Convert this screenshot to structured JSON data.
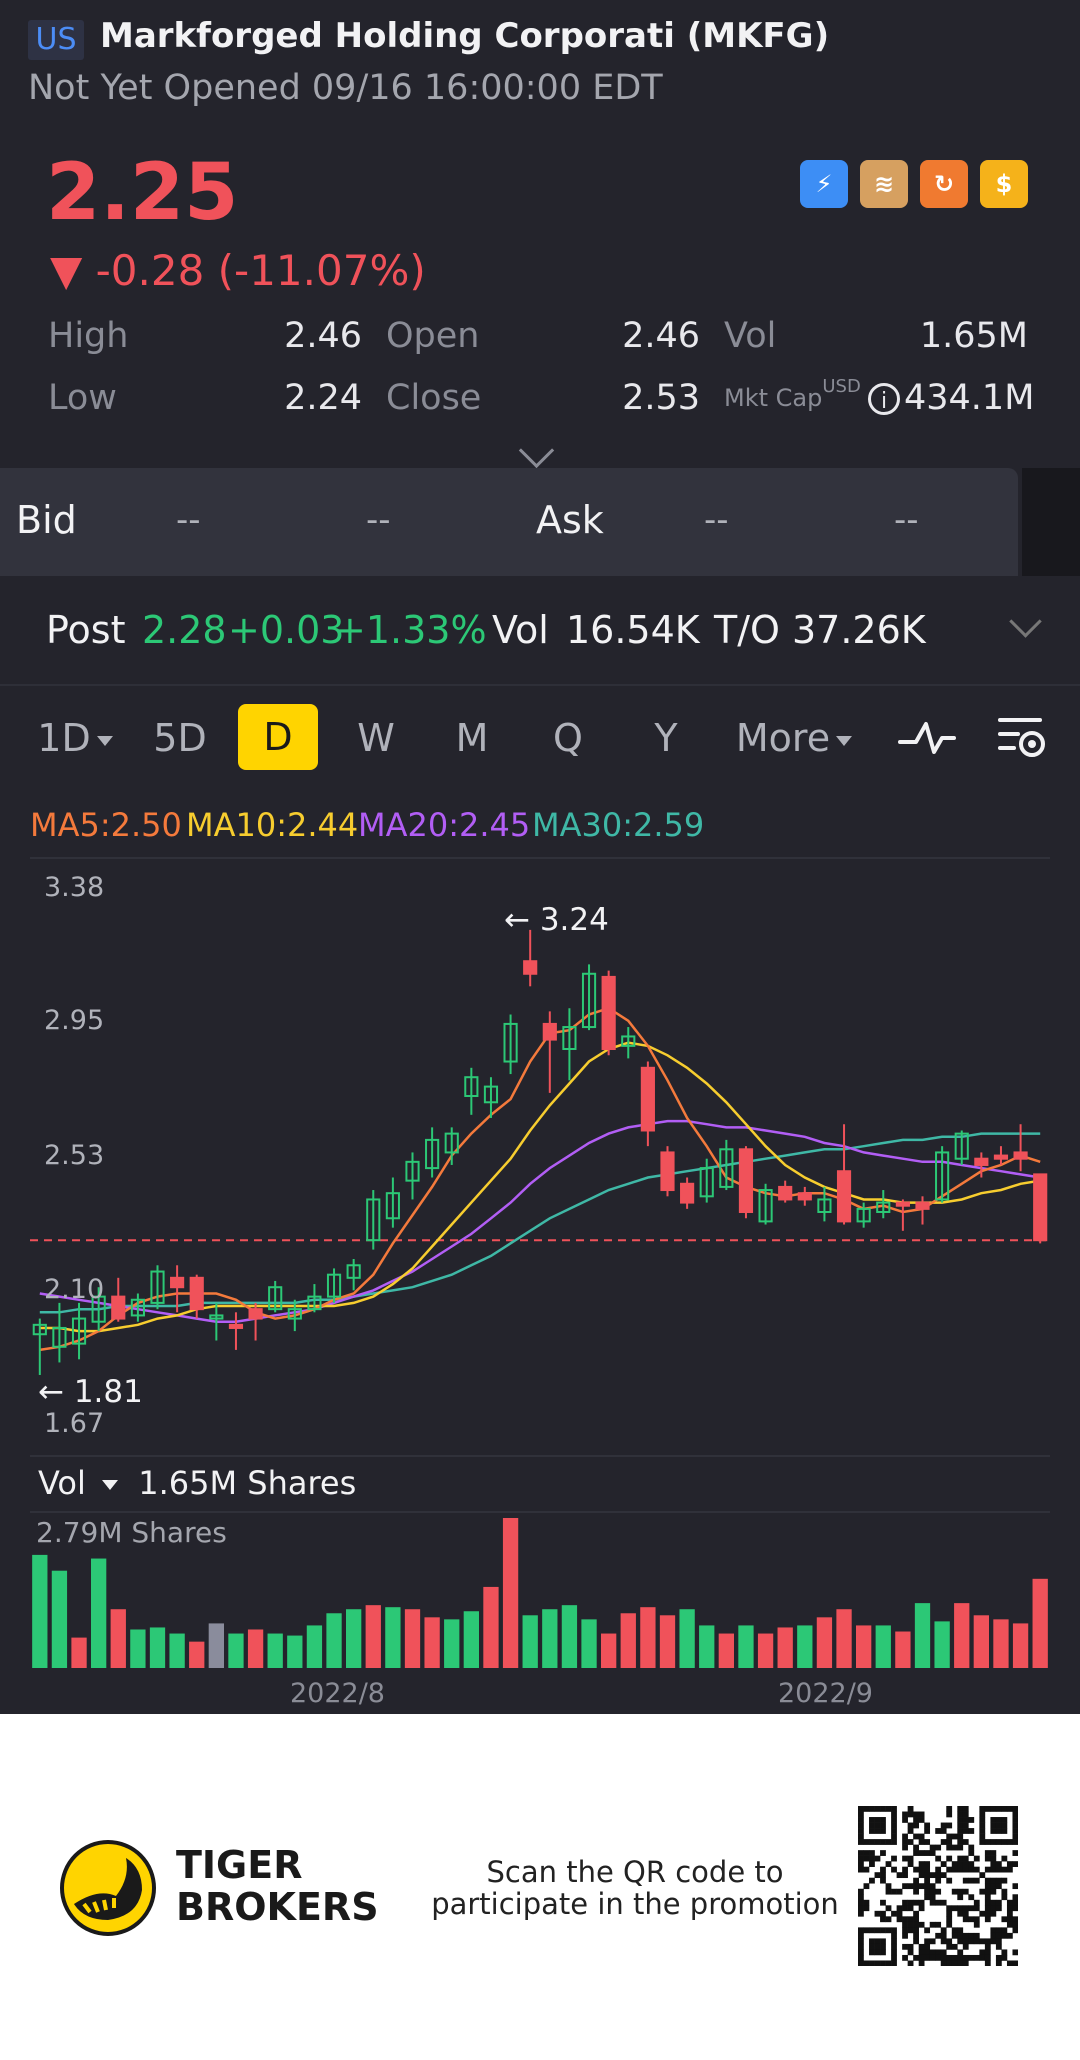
{
  "header": {
    "market": "US",
    "title": "Markforged Holding Corporati (MKFG)",
    "status": "Not Yet Opened 09/16 16:00:00 EDT",
    "price": "2.25",
    "change": "▼ -0.28 (-11.07%)",
    "icons": [
      "lightning-badge-icon",
      "stack-a-icon",
      "orange-cycle-icon",
      "dollar-icon"
    ],
    "icon_texts": [
      "⚡",
      "≋",
      "↻",
      "$"
    ]
  },
  "stats": {
    "high_label": "High",
    "high_value": "2.46",
    "low_label": "Low",
    "low_value": "2.24",
    "open_label": "Open",
    "open_value": "2.46",
    "close_label": "Close",
    "close_value": "2.53",
    "vol_label": "Vol",
    "vol_value": "1.65M",
    "mktcap_label": "Mkt Cap",
    "mktcap_currency": "USD",
    "mktcap_value": "434.1M"
  },
  "bidask": {
    "bid_label": "Bid",
    "bid_price": "--",
    "bid_size": "--",
    "ask_label": "Ask",
    "ask_price": "--",
    "ask_size": "--"
  },
  "post": {
    "label": "Post",
    "price": "2.28",
    "change": "+0.03",
    "pct": "+1.33%",
    "vol_label": "Vol",
    "vol_value": "16.54K",
    "to_label": "T/O",
    "to_value": "37.26K"
  },
  "tabs": [
    "1D",
    "5D",
    "D",
    "W",
    "M",
    "Q",
    "Y",
    "More"
  ],
  "active_tab": "D",
  "ma": {
    "ma5": "MA5:2.50",
    "ma10": "MA10:2.44",
    "ma20": "MA20:2.45",
    "ma30": "MA30:2.59",
    "colors": {
      "ma5": "#f47a3c",
      "ma10": "#f7cd2f",
      "ma20": "#b25ef5",
      "ma30": "#3fb8a6"
    }
  },
  "chart": {
    "y_ticks": [
      "3.38",
      "2.95",
      "2.53",
      "2.10",
      "1.67"
    ],
    "high_ann": "← 3.24",
    "low_ann": "← 1.81",
    "vol_header": "Vol",
    "vol_value": "1.65M Shares",
    "vol_max": "2.79M Shares",
    "x_ticks": [
      "2022/8",
      "2022/9"
    ],
    "colors": {
      "up": "#2cc876",
      "down": "#f0525a",
      "neutral": "#8a8c9c"
    }
  },
  "chart_data": {
    "type": "candlestick",
    "ylim": [
      1.67,
      3.38
    ],
    "reference_price": 2.25,
    "candles": [
      [
        1.95,
        1.98,
        1.82,
        2.0
      ],
      [
        1.91,
        1.97,
        1.86,
        2.05
      ],
      [
        1.92,
        2.0,
        1.87,
        2.05
      ],
      [
        1.99,
        2.07,
        1.96,
        2.1
      ],
      [
        2.07,
        2.0,
        1.99,
        2.13
      ],
      [
        2.01,
        2.06,
        1.99,
        2.08
      ],
      [
        2.05,
        2.15,
        2.03,
        2.17
      ],
      [
        2.13,
        2.1,
        2.02,
        2.17
      ],
      [
        2.13,
        2.03,
        2.0,
        2.14
      ],
      [
        2.0,
        2.01,
        1.93,
        2.05
      ],
      [
        1.98,
        1.97,
        1.9,
        2.02
      ],
      [
        2.03,
        2.0,
        1.93,
        2.05
      ],
      [
        2.03,
        2.1,
        2.02,
        2.12
      ],
      [
        2.0,
        2.03,
        1.96,
        2.06
      ],
      [
        2.03,
        2.07,
        2.02,
        2.11
      ],
      [
        2.07,
        2.14,
        2.05,
        2.16
      ],
      [
        2.13,
        2.17,
        2.09,
        2.19
      ],
      [
        2.25,
        2.38,
        2.22,
        2.41
      ],
      [
        2.32,
        2.4,
        2.29,
        2.45
      ],
      [
        2.44,
        2.5,
        2.38,
        2.53
      ],
      [
        2.48,
        2.57,
        2.45,
        2.61
      ],
      [
        2.53,
        2.59,
        2.49,
        2.61
      ],
      [
        2.71,
        2.77,
        2.65,
        2.8
      ],
      [
        2.69,
        2.74,
        2.64,
        2.77
      ],
      [
        2.82,
        2.94,
        2.78,
        2.97
      ],
      [
        3.14,
        3.1,
        3.06,
        3.24
      ],
      [
        2.94,
        2.89,
        2.72,
        2.98
      ],
      [
        2.86,
        2.93,
        2.76,
        2.99
      ],
      [
        2.93,
        3.1,
        2.92,
        3.13
      ],
      [
        3.09,
        2.86,
        2.84,
        3.11
      ],
      [
        2.87,
        2.9,
        2.83,
        2.93
      ],
      [
        2.8,
        2.6,
        2.55,
        2.82
      ],
      [
        2.53,
        2.41,
        2.39,
        2.55
      ],
      [
        2.43,
        2.37,
        2.35,
        2.45
      ],
      [
        2.39,
        2.48,
        2.37,
        2.51
      ],
      [
        2.42,
        2.54,
        2.41,
        2.57
      ],
      [
        2.54,
        2.34,
        2.32,
        2.55
      ],
      [
        2.31,
        2.41,
        2.3,
        2.43
      ],
      [
        2.42,
        2.38,
        2.37,
        2.44
      ],
      [
        2.4,
        2.38,
        2.36,
        2.42
      ],
      [
        2.34,
        2.38,
        2.31,
        2.42
      ],
      [
        2.47,
        2.31,
        2.3,
        2.62
      ],
      [
        2.31,
        2.35,
        2.29,
        2.37
      ],
      [
        2.34,
        2.37,
        2.32,
        2.41
      ],
      [
        2.37,
        2.36,
        2.28,
        2.38
      ],
      [
        2.37,
        2.35,
        2.3,
        2.39
      ],
      [
        2.38,
        2.53,
        2.37,
        2.55
      ],
      [
        2.51,
        2.59,
        2.49,
        2.6
      ],
      [
        2.51,
        2.49,
        2.45,
        2.53
      ],
      [
        2.52,
        2.51,
        2.49,
        2.55
      ],
      [
        2.53,
        2.51,
        2.47,
        2.62
      ],
      [
        2.46,
        2.25,
        2.24,
        2.46
      ]
    ],
    "ma5": [
      1.9,
      1.91,
      1.93,
      1.96,
      2.01,
      2.05,
      2.07,
      2.08,
      2.08,
      2.08,
      2.06,
      2.02,
      2.0,
      2.01,
      2.03,
      2.06,
      2.08,
      2.14,
      2.24,
      2.33,
      2.42,
      2.52,
      2.59,
      2.65,
      2.7,
      2.82,
      2.91,
      2.92,
      2.97,
      2.99,
      2.95,
      2.87,
      2.76,
      2.64,
      2.55,
      2.45,
      2.42,
      2.4,
      2.39,
      2.4,
      2.4,
      2.38,
      2.35,
      2.36,
      2.34,
      2.35,
      2.39,
      2.43,
      2.47,
      2.49,
      2.52,
      2.5
    ],
    "ma10": [
      1.97,
      1.97,
      1.96,
      1.96,
      1.97,
      1.98,
      2.0,
      2.01,
      2.03,
      2.04,
      2.04,
      2.04,
      2.04,
      2.04,
      2.04,
      2.04,
      2.05,
      2.07,
      2.11,
      2.16,
      2.23,
      2.3,
      2.37,
      2.44,
      2.51,
      2.6,
      2.68,
      2.75,
      2.82,
      2.86,
      2.88,
      2.87,
      2.84,
      2.8,
      2.75,
      2.69,
      2.62,
      2.55,
      2.49,
      2.45,
      2.42,
      2.4,
      2.38,
      2.38,
      2.37,
      2.37,
      2.37,
      2.38,
      2.4,
      2.41,
      2.43,
      2.44
    ],
    "ma20": [
      2.08,
      2.07,
      2.06,
      2.05,
      2.04,
      2.03,
      2.02,
      2.01,
      2.0,
      1.99,
      1.99,
      2.0,
      2.01,
      2.02,
      2.03,
      2.05,
      2.07,
      2.09,
      2.12,
      2.15,
      2.19,
      2.23,
      2.27,
      2.32,
      2.37,
      2.43,
      2.48,
      2.52,
      2.56,
      2.59,
      2.61,
      2.62,
      2.63,
      2.63,
      2.62,
      2.61,
      2.61,
      2.6,
      2.59,
      2.58,
      2.56,
      2.55,
      2.53,
      2.52,
      2.51,
      2.5,
      2.5,
      2.49,
      2.48,
      2.47,
      2.46,
      2.45
    ],
    "ma30": [
      2.02,
      2.02,
      2.03,
      2.03,
      2.04,
      2.04,
      2.04,
      2.04,
      2.05,
      2.05,
      2.05,
      2.05,
      2.05,
      2.05,
      2.06,
      2.06,
      2.07,
      2.08,
      2.09,
      2.1,
      2.12,
      2.14,
      2.17,
      2.2,
      2.24,
      2.28,
      2.32,
      2.35,
      2.38,
      2.41,
      2.43,
      2.45,
      2.46,
      2.47,
      2.48,
      2.49,
      2.5,
      2.51,
      2.52,
      2.53,
      2.54,
      2.54,
      2.55,
      2.56,
      2.57,
      2.57,
      2.58,
      2.58,
      2.59,
      2.59,
      2.59,
      2.59
    ],
    "volume_max": 2.79,
    "volumes": [
      2.79,
      2.4,
      0.75,
      2.7,
      1.45,
      0.95,
      1.0,
      0.85,
      0.65,
      1.1,
      0.85,
      0.95,
      0.85,
      0.8,
      1.05,
      1.35,
      1.45,
      1.55,
      1.5,
      1.45,
      1.25,
      1.2,
      1.4,
      2.0,
      3.7,
      1.3,
      1.45,
      1.55,
      1.2,
      0.85,
      1.35,
      1.5,
      1.3,
      1.45,
      1.05,
      0.85,
      1.05,
      0.85,
      1.0,
      1.05,
      1.25,
      1.45,
      1.05,
      1.05,
      0.9,
      1.6,
      1.15,
      1.6,
      1.3,
      1.2,
      1.1,
      2.2
    ],
    "volume_dir": [
      "up",
      "up",
      "down",
      "up",
      "down",
      "up",
      "up",
      "up",
      "down",
      "neutral",
      "up",
      "down",
      "up",
      "up",
      "up",
      "up",
      "up",
      "down",
      "up",
      "down",
      "down",
      "up",
      "up",
      "down",
      "down",
      "up",
      "up",
      "up",
      "up",
      "down",
      "down",
      "down",
      "down",
      "up",
      "up",
      "down",
      "up",
      "down",
      "down",
      "up",
      "down",
      "down",
      "down",
      "up",
      "down",
      "up",
      "up",
      "down",
      "down",
      "down",
      "down",
      "down"
    ],
    "x_labels": [
      "2022/8",
      "2022/9"
    ]
  },
  "footer": {
    "brand_line1": "TIGER",
    "brand_line2": "BROKERS",
    "promo_line1": "Scan the QR code to",
    "promo_line2": "participate in the promotion"
  }
}
